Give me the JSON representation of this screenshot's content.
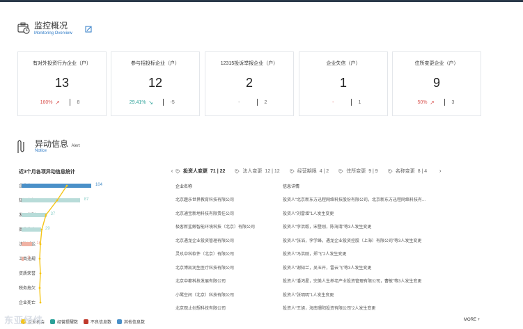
{
  "monitoring": {
    "title": "监控概况",
    "subtitle": "Monitoring Overview"
  },
  "cards": [
    {
      "title": "有对外投资行为企业（户）",
      "value": "13",
      "pct": "160%",
      "pct_color": "red",
      "trend": "up",
      "delta": "8"
    },
    {
      "title": "参与招投标企业（户）",
      "value": "12",
      "pct": "29.41%",
      "pct_color": "green",
      "trend": "down",
      "delta": "-5"
    },
    {
      "title": "12315投诉举报企业（户）",
      "value": "2",
      "pct": "-",
      "pct_color": "gray",
      "trend": "",
      "delta": "2"
    },
    {
      "title": "企业失信（户）",
      "value": "1",
      "pct": "-",
      "pct_color": "red",
      "trend": "",
      "delta": "1"
    },
    {
      "title": "住所变更企业（户）",
      "value": "9",
      "pct": "50%",
      "pct_color": "red",
      "trend": "up",
      "delta": "3"
    }
  ],
  "alert": {
    "title": "异动信息",
    "title_en": "Alert",
    "subtitle": "Notice"
  },
  "stats_title": "近3个月各项异动信息统计",
  "chart_data": {
    "type": "bar",
    "orientation": "horizontal",
    "categories": [
      "企业变更",
      "知识产权",
      "发展扩张",
      "商业信息",
      "法院诉讼",
      "工商违规",
      "资质荣誉",
      "税务拖欠",
      "企业死亡"
    ],
    "values": [
      104,
      87,
      37,
      29,
      16,
      3,
      0,
      0,
      0
    ],
    "value_labels": [
      "104",
      "87",
      "37",
      "29",
      "16",
      "3",
      "",
      "",
      ""
    ],
    "bar_colors": [
      "#4a90c8",
      "#b8dcd9",
      "#b8dcd9",
      "#b8dcd9",
      "#f0b2a4",
      "#f0b2a4",
      "#b8dcd9",
      "#b8dcd9",
      "#b8dcd9"
    ],
    "label_colors": [
      "#4a90c8",
      "#8ccfc9",
      "#8ccfc9",
      "#8ccfc9",
      "#f0a090",
      "#f0a090",
      "#8ccfc9",
      "#8ccfc9",
      "#8ccfc9"
    ],
    "line_color": "#f5c518",
    "xlim": [
      0,
      110
    ],
    "legend": [
      "企业机会",
      "经营提醒数",
      "不良信息数",
      "其他信息数"
    ],
    "legend_colors": [
      "#f5c518",
      "#2aa198",
      "#c0392b",
      "#4a90c8"
    ]
  },
  "tabs": [
    {
      "label": "投资人变更",
      "count": "71 | 22",
      "active": true
    },
    {
      "label": "法人变更",
      "count": "12 | 12",
      "active": false
    },
    {
      "label": "经营期限",
      "count": "4 | 2",
      "active": false
    },
    {
      "label": "住所变更",
      "count": "9 | 9",
      "active": false
    },
    {
      "label": "名称变更",
      "count": "8 | 4",
      "active": false
    }
  ],
  "table": {
    "col_company": "企业名称",
    "col_detail": "信息详情",
    "rows": [
      {
        "company": "北京趣乐世界教育科技有限公司",
        "detail": "投资人“北京新东方迅程网络科技股份有限公司，北京新东方迅程网络科技有..."
      },
      {
        "company": "北京通宝新地科技有限责任公司",
        "detail": "投资人“刘雷增”1人发生变更"
      },
      {
        "company": "极客新鲨鲸智能环境科技（北京）有限公司",
        "detail": "投资人“李洪毅，宋登刚，陈海清”等3人发生变更"
      },
      {
        "company": "北京遇龙企业投资管理有限公司",
        "detail": "投资人“张滔，李学峰，遇龙企业投资控股（上海）有限公司”等3人发生变更"
      },
      {
        "company": "灵玖中科软件（北京）有限公司",
        "detail": "投资人“冯洪刚，郑飞”2人发生变更"
      },
      {
        "company": "北京博凯润生医疗科技有限公司",
        "detail": "投资人“谢知兰，吴玉开，雷云飞”等3人发生变更"
      },
      {
        "company": "北京中都科技发展有限公司",
        "detail": "投资人“潘鸿星，完美人生养老产业投资管理有限公司，曹敏”等3人发生变更"
      },
      {
        "company": "小鹭空间（北京）科技有限公司",
        "detail": "投资人“张明明”1人发生变更"
      },
      {
        "company": "北京观止创想科技有限公司",
        "detail": "投资人“王旭，海南珊阳投资有限公司”2人发生变更"
      }
    ]
  },
  "more_label": "MORE +",
  "watermark": "东亚经纬"
}
